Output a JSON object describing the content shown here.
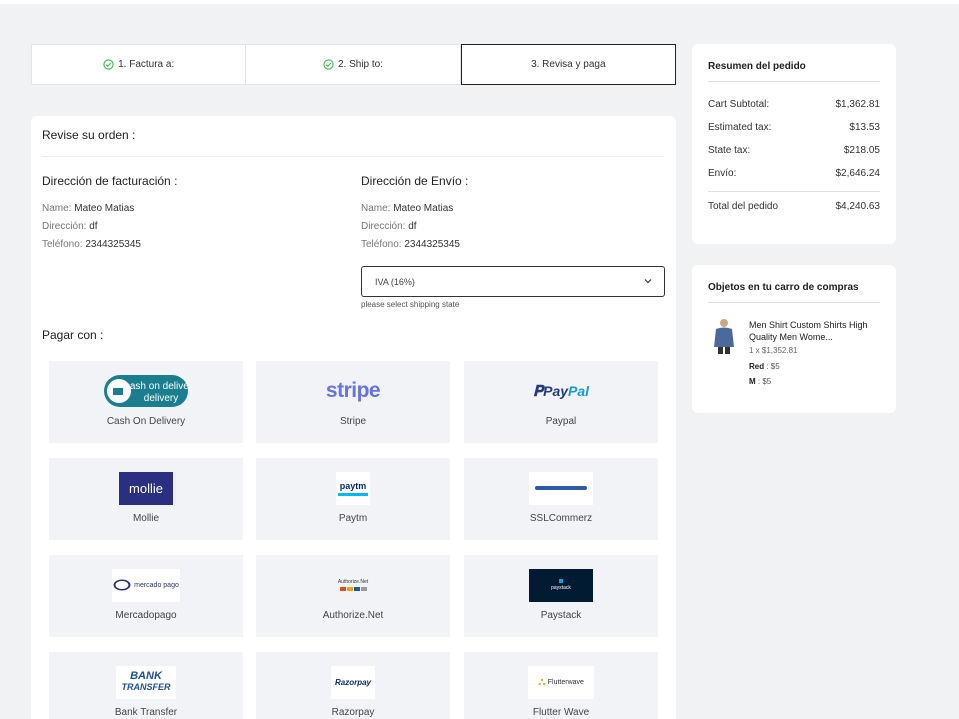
{
  "steps": [
    {
      "label": "1. Factura a:",
      "done": true
    },
    {
      "label": "2. Ship to:",
      "done": true
    },
    {
      "label": "3. Revisa y paga",
      "done": false
    }
  ],
  "review": {
    "title": "Revise su orden :",
    "billing": {
      "title": "Dirección de facturación :",
      "name_label": "Name:",
      "name": "Mateo Matias",
      "address_label": "Dirección:",
      "address": "df",
      "phone_label": "Teléfono:",
      "phone": "2344325345"
    },
    "shipping": {
      "title": "Dirección de Envío :",
      "name_label": "Name:",
      "name": "Mateo Matias",
      "address_label": "Dirección:",
      "address": "df",
      "phone_label": "Teléfono:",
      "phone": "2344325345"
    },
    "tax_select": {
      "value": "IVA (16%)",
      "hint": "please select shipping state"
    }
  },
  "payment": {
    "title": "Pagar con :",
    "methods": [
      {
        "label": "Cash On Delivery",
        "logo_text": "cash on delivery",
        "icon": "cash-on-delivery-logo"
      },
      {
        "label": "Stripe",
        "logo_text": "stripe",
        "icon": "stripe-logo"
      },
      {
        "label": "Paypal",
        "logo_text": "PayPal",
        "icon": "paypal-logo"
      },
      {
        "label": "Mollie",
        "logo_text": "mollie",
        "icon": "mollie-logo"
      },
      {
        "label": "Paytm",
        "logo_text": "paytm",
        "icon": "paytm-logo"
      },
      {
        "label": "SSLCommerz",
        "logo_text": "",
        "icon": "sslcommerz-logo"
      },
      {
        "label": "Mercadopago",
        "logo_text": "mercado pago",
        "icon": "mercadopago-logo"
      },
      {
        "label": "Authorize.Net",
        "logo_text": "Authorize.Net",
        "icon": "authorize-net-logo"
      },
      {
        "label": "Paystack",
        "logo_text": "paystack",
        "icon": "paystack-logo"
      },
      {
        "label": "Bank Transfer",
        "logo_text": "BANK TRANSFER",
        "icon": "bank-transfer-logo"
      },
      {
        "label": "Razorpay",
        "logo_text": "Razorpay",
        "icon": "razorpay-logo"
      },
      {
        "label": "Flutter Wave",
        "logo_text": "Flutterwave",
        "icon": "flutterwave-logo"
      }
    ]
  },
  "summary": {
    "title": "Resumen del pedido",
    "rows": [
      {
        "label": "Cart Subtotal:",
        "value": "$1,362.81"
      },
      {
        "label": "Estimated tax:",
        "value": "$13.53"
      },
      {
        "label": "State tax:",
        "value": "$218.05"
      },
      {
        "label": "Envío:",
        "value": "$2,646.24"
      }
    ],
    "total": {
      "label": "Total del pedido",
      "value": "$4,240.63"
    }
  },
  "cart": {
    "title": "Objetos en tu carro de compras",
    "item": {
      "name": "Men Shirt Custom Shirts High Quality Men Wome...",
      "qty": "1 x $1,352.81",
      "variants": [
        {
          "name": "Red",
          "price": "$5"
        },
        {
          "name": "M",
          "price": "$5"
        }
      ]
    }
  },
  "colors": {
    "check": "#3bb54a",
    "paypal_dark": "#253b80",
    "paypal_light": "#179bd7",
    "stripe": "#6772e5",
    "mollie": "#2b2f82",
    "cod": "#1b7e8f"
  }
}
